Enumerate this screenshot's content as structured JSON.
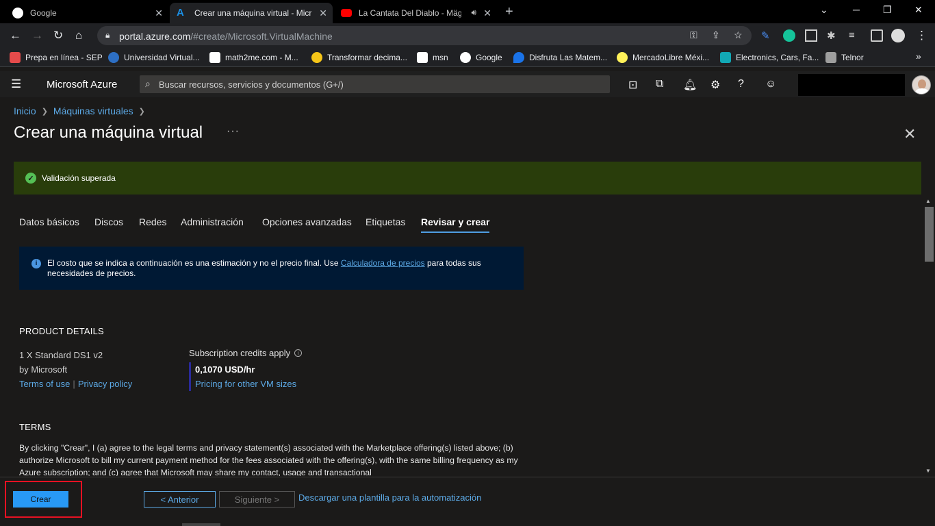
{
  "browser": {
    "tabs": [
      {
        "title": "Google",
        "favicon_color": "#ffffff"
      },
      {
        "title": "Crear una máquina virtual - Micr",
        "favicon_color": "#1b8fe4"
      },
      {
        "title": "La Cantata Del Diablo - Mägo",
        "favicon_color": "#ff0000"
      }
    ],
    "url_host": "portal.azure.com",
    "url_path": "/#create/Microsoft.VirtualMachine",
    "bookmarks": [
      {
        "label": "Prepa en línea - SEP",
        "color": "#e54b4b"
      },
      {
        "label": "Universidad Virtual...",
        "color": "#2d6fc4"
      },
      {
        "label": "math2me.com - M...",
        "color": "#ffffff"
      },
      {
        "label": "Transformar decima...",
        "color": "#f5c518"
      },
      {
        "label": "msn",
        "color": "#ffffff"
      },
      {
        "label": "Google",
        "color": "#ffffff"
      },
      {
        "label": "Disfruta Las Matem...",
        "color": "#1a73e8"
      },
      {
        "label": "MercadoLibre Méxi...",
        "color": "#fff159"
      },
      {
        "label": "Electronics, Cars, Fa...",
        "color": "#12a8b5"
      },
      {
        "label": "Telnor",
        "color": "#9e9e9e"
      }
    ]
  },
  "azure": {
    "brand": "Microsoft Azure",
    "search_placeholder": "Buscar recursos, servicios y documentos (G+/)"
  },
  "breadcrumb": [
    "Inicio",
    "Máquinas virtuales"
  ],
  "page": {
    "title": "Crear una máquina virtual",
    "more": "···",
    "validation": "Validación superada"
  },
  "tabs": [
    {
      "label": "Datos básicos"
    },
    {
      "label": "Discos"
    },
    {
      "label": "Redes"
    },
    {
      "label": "Administración"
    },
    {
      "label": "Opciones avanzadas"
    },
    {
      "label": "Etiquetas"
    },
    {
      "label": "Revisar y crear",
      "active": true
    }
  ],
  "info": {
    "text_before": "El costo que se indica a continuación es una estimación y no el precio final. Use ",
    "link": "Calculadora de precios",
    "text_after": " para todas sus necesidades de precios."
  },
  "product_details": {
    "heading": "PRODUCT DETAILS",
    "name": "1 X Standard DS1 v2",
    "publisher": "by Microsoft",
    "terms_link": "Terms of use",
    "privacy_link": "Privacy policy",
    "credits": "Subscription credits apply",
    "price": "0,1070 USD/hr",
    "pricing_link": "Pricing for other VM sizes"
  },
  "terms": {
    "heading": "TERMS",
    "text": "By clicking \"Crear\", I (a) agree to the legal terms and privacy statement(s) associated with the Marketplace offering(s) listed above; (b) authorize Microsoft to bill my current payment method for the fees associated with the offering(s), with the same billing frequency as my Azure subscription; and (c) agree that Microsoft may share my contact, usage and transactional"
  },
  "footer": {
    "create": "Crear",
    "previous": "< Anterior",
    "next": "Siguiente >",
    "download": "Descargar una plantilla para la automatización"
  }
}
